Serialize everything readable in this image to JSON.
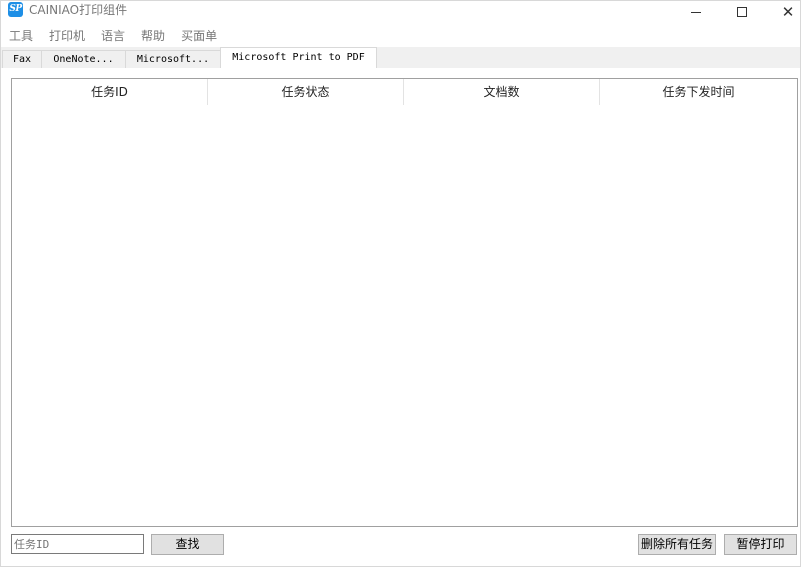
{
  "window": {
    "icon_text": "SP",
    "title": "CAINIAO打印组件",
    "close_glyph": "✕"
  },
  "menu": {
    "items": [
      "工具",
      "打印机",
      "语言",
      "帮助",
      "买面单"
    ]
  },
  "tabs": [
    {
      "label": "Fax"
    },
    {
      "label": "OneNote..."
    },
    {
      "label": "Microsoft..."
    },
    {
      "label": "Microsoft Print to PDF",
      "active": true
    }
  ],
  "grid": {
    "columns": [
      "任务ID",
      "任务状态",
      "文档数",
      "任务下发时间"
    ],
    "rows": []
  },
  "footer": {
    "search_placeholder": "任务ID",
    "find_label": "查找",
    "delete_all_label": "删除所有任务",
    "pause_label": "暂停打印"
  }
}
